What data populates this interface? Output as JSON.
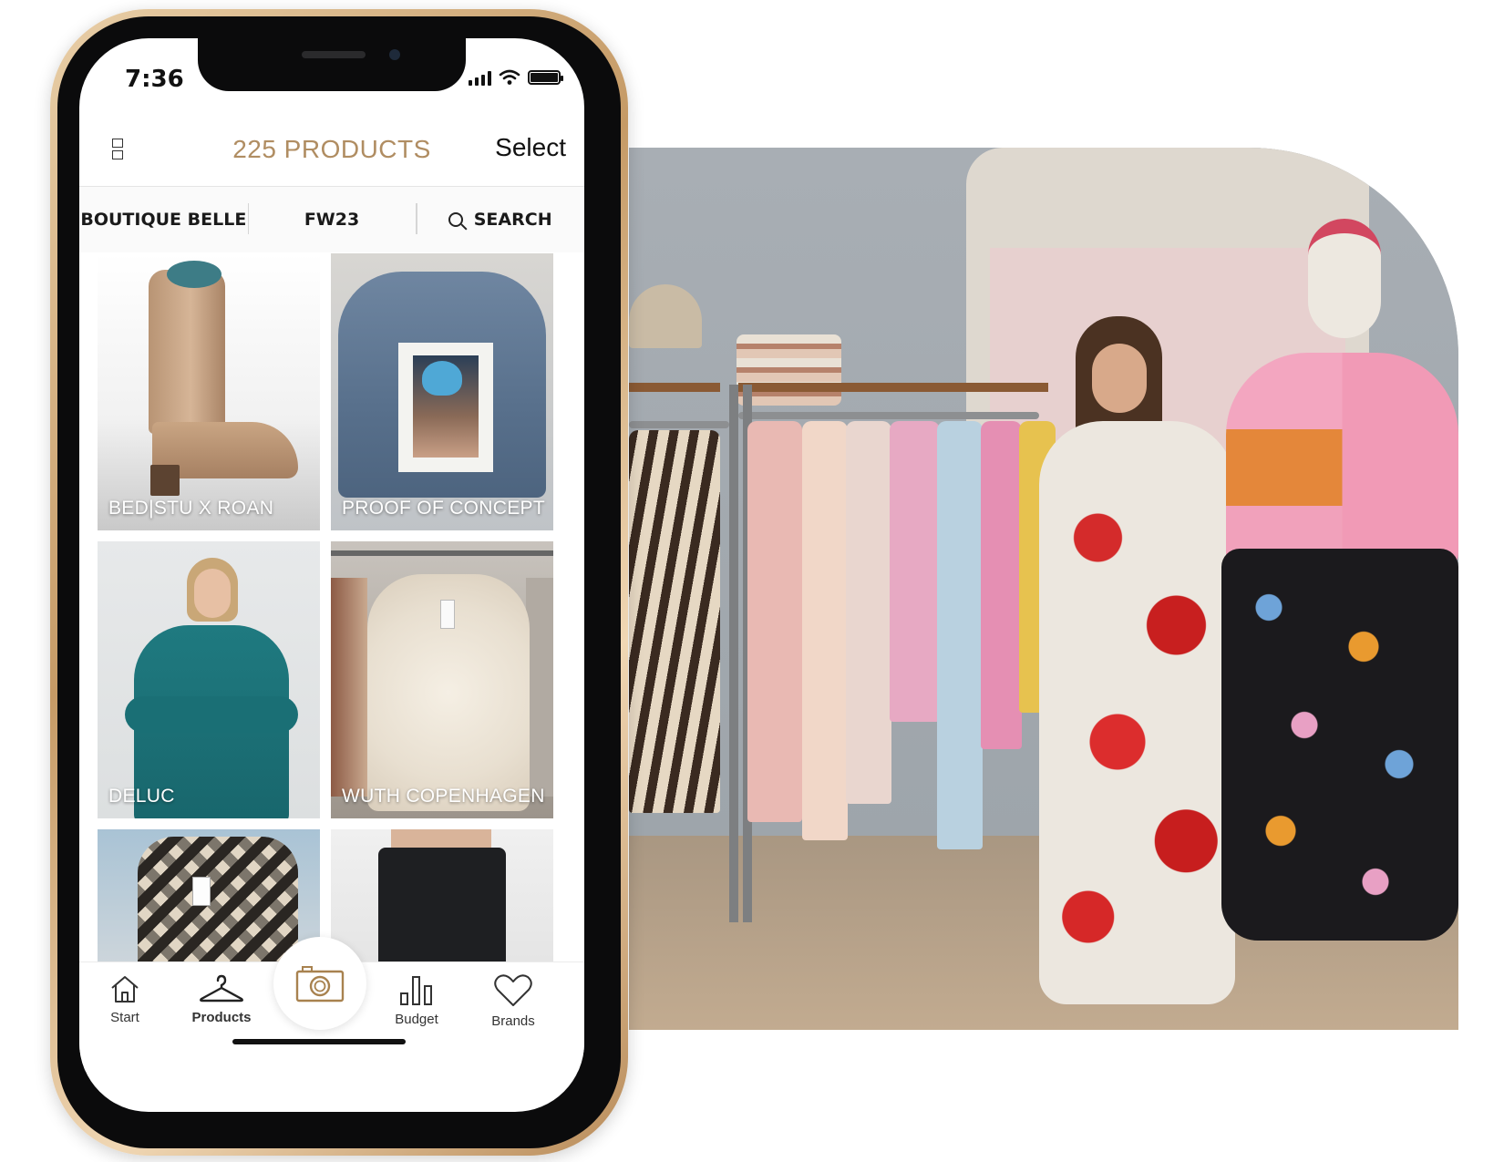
{
  "status_bar": {
    "time": "7:36"
  },
  "header": {
    "title": "225 PRODUCTS",
    "select_label": "Select",
    "accent_color": "#b08d62"
  },
  "filters": {
    "store": "BOUTIQUE BELLE",
    "season": "FW23",
    "search_label": "SEARCH"
  },
  "products": [
    {
      "brand": "BED|STU X ROAN"
    },
    {
      "brand": "PROOF OF CONCEPT"
    },
    {
      "brand": "DELUC"
    },
    {
      "brand": "WUTH COPENHAGEN"
    },
    {
      "brand": ""
    },
    {
      "brand": ""
    }
  ],
  "tab_bar": {
    "tabs": [
      {
        "label": "Start",
        "icon": "home-icon"
      },
      {
        "label": "Products",
        "icon": "hanger-icon",
        "active": true
      },
      {
        "label": "Budget",
        "icon": "bar-chart-icon"
      },
      {
        "label": "Brands",
        "icon": "heart-icon"
      }
    ],
    "center_action_icon": "camera-icon"
  },
  "photo": {
    "subject": "store-photo"
  }
}
